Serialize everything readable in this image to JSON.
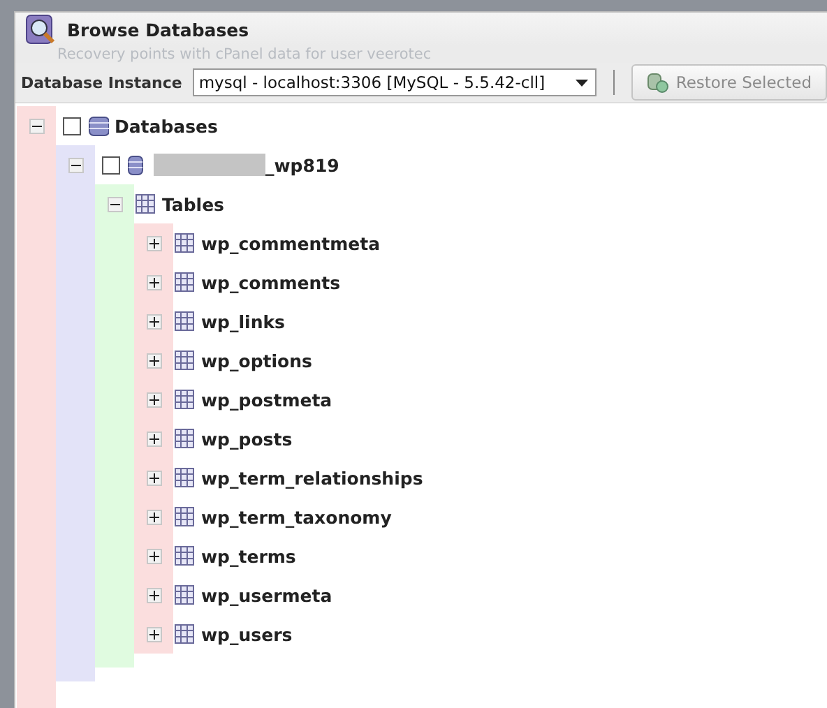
{
  "window": {
    "title": "Browse Databases",
    "background_text": "Recovery points with cPanel data for user veerotec"
  },
  "toolbar": {
    "instance_label": "Database Instance",
    "instance_value": "mysql - localhost:3306 [MySQL - 5.5.42-cll]",
    "restore_button": {
      "label": "Restore Selected",
      "disabled": true
    }
  },
  "tree": [
    {
      "kind": "server",
      "label": "Databases",
      "expanded": true,
      "checked": false,
      "children": [
        {
          "kind": "database",
          "label": "_wp819",
          "redacted": true,
          "expanded": true,
          "checked": false,
          "children": [
            {
              "kind": "folder",
              "label": "Tables",
              "expanded": true,
              "children": [
                {
                  "kind": "table",
                  "label": "wp_commentmeta",
                  "expanded": false
                },
                {
                  "kind": "table",
                  "label": "wp_comments",
                  "expanded": false
                },
                {
                  "kind": "table",
                  "label": "wp_links",
                  "expanded": false
                },
                {
                  "kind": "table",
                  "label": "wp_options",
                  "expanded": false
                },
                {
                  "kind": "table",
                  "label": "wp_postmeta",
                  "expanded": false
                },
                {
                  "kind": "table",
                  "label": "wp_posts",
                  "expanded": false
                },
                {
                  "kind": "table",
                  "label": "wp_term_relationships",
                  "expanded": false
                },
                {
                  "kind": "table",
                  "label": "wp_term_taxonomy",
                  "expanded": false
                },
                {
                  "kind": "table",
                  "label": "wp_terms",
                  "expanded": false
                },
                {
                  "kind": "table",
                  "label": "wp_usermeta",
                  "expanded": false
                },
                {
                  "kind": "table",
                  "label": "wp_users",
                  "expanded": false
                }
              ]
            }
          ]
        }
      ]
    }
  ]
}
